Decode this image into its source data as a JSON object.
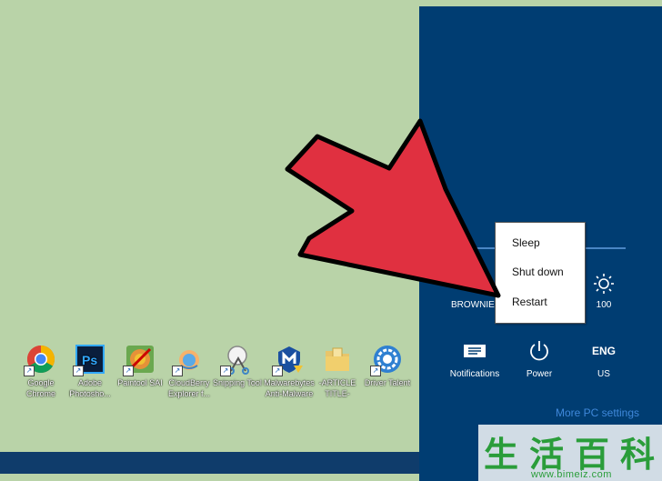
{
  "desktop": {
    "icons": [
      {
        "label": "",
        "icon": "partial-icon"
      },
      {
        "label": "Google\nChrome",
        "icon": "chrome-icon"
      },
      {
        "label": "Adobe\nPhotosho...",
        "icon": "photoshop-icon"
      },
      {
        "label": "Paintool SAI",
        "icon": "paintool-sai-icon"
      },
      {
        "label": "CloudBerry\nExplorer f...",
        "icon": "cloudberry-icon"
      },
      {
        "label": "Snipping Tool",
        "icon": "snipping-tool-icon"
      },
      {
        "label": "Malwarebytes\nAnti-Malware",
        "icon": "malwarebytes-icon"
      },
      {
        "label": "-ARTICLE\nTITLE-",
        "icon": "folder-icon"
      },
      {
        "label": "Driver Talent",
        "icon": "driver-talent-icon"
      }
    ]
  },
  "charms": {
    "network_label": "BROWNIES",
    "brightness_value": "100",
    "quick_settings": [
      {
        "label": "Notifications",
        "icon": "notifications-icon"
      },
      {
        "label": "Power",
        "icon": "power-icon"
      },
      {
        "label": "US",
        "icon_text": "ENG"
      }
    ],
    "more_link": "More PC settings"
  },
  "power_menu": {
    "items": [
      "Sleep",
      "Shut down",
      "Restart"
    ]
  },
  "overlay": {
    "arrow_color": "#e03040",
    "watermark_chars": [
      "生",
      "活",
      "百",
      "科"
    ],
    "watermark_url": "www.bimeiz.com"
  },
  "colors": {
    "desktop_bg": "#b9d3a8",
    "charms_bg": "#003d72",
    "accent": "#3f88da"
  }
}
